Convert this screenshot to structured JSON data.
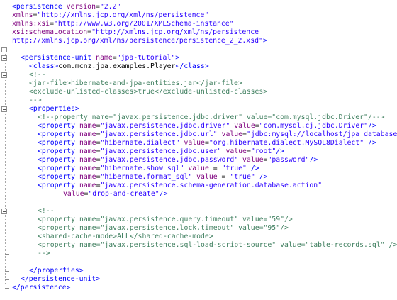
{
  "editor": {
    "lines": [
      {
        "indent": 0,
        "segs": [
          [
            "tag",
            "<persistence "
          ],
          [
            "attr",
            "version"
          ],
          [
            "txt",
            "="
          ],
          [
            "str",
            "\"2.2\""
          ]
        ]
      },
      {
        "indent": 0,
        "segs": [
          [
            "attr",
            "xmlns"
          ],
          [
            "txt",
            "="
          ],
          [
            "str",
            "\"http://xmlns.jcp.org/xml/ns/persistence\""
          ]
        ]
      },
      {
        "indent": 0,
        "segs": [
          [
            "attr",
            "xmlns:xsi"
          ],
          [
            "txt",
            "="
          ],
          [
            "str",
            "\"http://www.w3.org/2001/XMLSchema-instance\""
          ]
        ]
      },
      {
        "indent": 0,
        "segs": [
          [
            "attr",
            "xsi:schemaLocation"
          ],
          [
            "txt",
            "="
          ],
          [
            "str",
            "\"http://xmlns.jcp.org/xml/ns/persistence"
          ]
        ]
      },
      {
        "indent": 0,
        "segs": [
          [
            "str",
            "http://xmlns.jcp.org/xml/ns/persistence/persistence_2_2.xsd\""
          ],
          [
            "tag",
            ">"
          ]
        ]
      },
      {
        "indent": 0,
        "segs": []
      },
      {
        "indent": 1,
        "segs": [
          [
            "tag",
            "<persistence-unit "
          ],
          [
            "attr",
            "name"
          ],
          [
            "txt",
            "="
          ],
          [
            "str",
            "\"jpa-tutorial\""
          ],
          [
            "tag",
            ">"
          ]
        ]
      },
      {
        "indent": 2,
        "segs": [
          [
            "tag",
            "<class>"
          ],
          [
            "txt",
            "com.mcnz.jpa.examples.Player"
          ],
          [
            "tag",
            "</class>"
          ]
        ]
      },
      {
        "indent": 2,
        "segs": [
          [
            "cmt",
            "<!--"
          ]
        ]
      },
      {
        "indent": 2,
        "segs": [
          [
            "cmt",
            "<jar-file>hibernate-and-jpa-entities.jar</jar-file>"
          ]
        ]
      },
      {
        "indent": 2,
        "segs": [
          [
            "cmt",
            "<exclude-unlisted-classes>true</exclude-unlisted-classes>"
          ]
        ]
      },
      {
        "indent": 2,
        "segs": [
          [
            "cmt",
            "-->"
          ]
        ]
      },
      {
        "indent": 2,
        "segs": [
          [
            "tag",
            "<properties>"
          ]
        ]
      },
      {
        "indent": 3,
        "segs": [
          [
            "cmt",
            "<!--property name=\"javax.persistence.jdbc.driver\" value=\"com.mysql.jdbc.Driver\"/-->"
          ]
        ]
      },
      {
        "indent": 3,
        "segs": [
          [
            "tag",
            "<property "
          ],
          [
            "attr",
            "name"
          ],
          [
            "txt",
            "="
          ],
          [
            "str",
            "\"javax.persistence.jdbc.driver\""
          ],
          [
            "txt",
            " "
          ],
          [
            "attr",
            "value"
          ],
          [
            "txt",
            "="
          ],
          [
            "str",
            "\"com.mysql.cj.jdbc.Driver\""
          ],
          [
            "tag",
            "/>"
          ]
        ]
      },
      {
        "indent": 3,
        "segs": [
          [
            "tag",
            "<property "
          ],
          [
            "attr",
            "name"
          ],
          [
            "txt",
            "="
          ],
          [
            "str",
            "\"javax.persistence.jdbc.url\""
          ],
          [
            "txt",
            " "
          ],
          [
            "attr",
            "value"
          ],
          [
            "txt",
            "="
          ],
          [
            "str",
            "\"jdbc:mysql://localhost/jpa_database\""
          ],
          [
            "tag",
            "/>"
          ]
        ]
      },
      {
        "indent": 3,
        "segs": [
          [
            "tag",
            "<property "
          ],
          [
            "attr",
            "name"
          ],
          [
            "txt",
            "="
          ],
          [
            "str",
            "\"hibernate.dialect\""
          ],
          [
            "txt",
            " "
          ],
          [
            "attr",
            "value"
          ],
          [
            "txt",
            "="
          ],
          [
            "str",
            "\"org.hibernate.dialect.MySQL8Dialect\""
          ],
          [
            "txt",
            " "
          ],
          [
            "tag",
            "/>"
          ]
        ]
      },
      {
        "indent": 3,
        "segs": [
          [
            "tag",
            "<property "
          ],
          [
            "attr",
            "name"
          ],
          [
            "txt",
            "="
          ],
          [
            "str",
            "\"javax.persistence.jdbc.user\""
          ],
          [
            "txt",
            " "
          ],
          [
            "attr",
            "value"
          ],
          [
            "txt",
            "="
          ],
          [
            "str",
            "\"root\""
          ],
          [
            "tag",
            "/>"
          ]
        ]
      },
      {
        "indent": 3,
        "segs": [
          [
            "tag",
            "<property "
          ],
          [
            "attr",
            "name"
          ],
          [
            "txt",
            "="
          ],
          [
            "str",
            "\"javax.persistence.jdbc.password\""
          ],
          [
            "txt",
            " "
          ],
          [
            "attr",
            "value"
          ],
          [
            "txt",
            "="
          ],
          [
            "str",
            "\"password\""
          ],
          [
            "tag",
            "/>"
          ]
        ]
      },
      {
        "indent": 3,
        "segs": [
          [
            "tag",
            "<property "
          ],
          [
            "attr",
            "name"
          ],
          [
            "txt",
            "="
          ],
          [
            "str",
            "\"hibernate.show_sql\""
          ],
          [
            "txt",
            " "
          ],
          [
            "attr",
            "value"
          ],
          [
            "txt",
            " = "
          ],
          [
            "str",
            "\"true\""
          ],
          [
            "txt",
            " "
          ],
          [
            "tag",
            "/>"
          ]
        ]
      },
      {
        "indent": 3,
        "segs": [
          [
            "tag",
            "<property "
          ],
          [
            "attr",
            "name"
          ],
          [
            "txt",
            "="
          ],
          [
            "str",
            "\"hibernate.format_sql\""
          ],
          [
            "txt",
            " "
          ],
          [
            "attr",
            "value"
          ],
          [
            "txt",
            " = "
          ],
          [
            "str",
            "\"true\""
          ],
          [
            "txt",
            " "
          ],
          [
            "tag",
            "/>"
          ]
        ]
      },
      {
        "indent": 3,
        "segs": [
          [
            "tag",
            "<property "
          ],
          [
            "attr",
            "name"
          ],
          [
            "txt",
            "="
          ],
          [
            "str",
            "\"javax.persistence.schema-generation.database.action\""
          ]
        ]
      },
      {
        "indent": 6,
        "segs": [
          [
            "attr",
            "value"
          ],
          [
            "txt",
            "="
          ],
          [
            "str",
            "\"drop-and-create\""
          ],
          [
            "tag",
            "/>"
          ]
        ]
      },
      {
        "indent": 0,
        "segs": []
      },
      {
        "indent": 3,
        "segs": [
          [
            "cmt",
            "<!--"
          ]
        ]
      },
      {
        "indent": 3,
        "segs": [
          [
            "cmt",
            "<property name=\"javax.persistence.query.timeout\" value=\"59\"/>"
          ]
        ]
      },
      {
        "indent": 3,
        "segs": [
          [
            "cmt",
            "<property name=\"javax.persistence.lock.timeout\" value=\"95\"/>"
          ]
        ]
      },
      {
        "indent": 3,
        "segs": [
          [
            "cmt",
            "<shared-cache-mode>ALL</shared-cache-mode>"
          ]
        ]
      },
      {
        "indent": 3,
        "segs": [
          [
            "cmt",
            "<property name=\"javax.persistence.sql-load-script-source\" value=\"table-records.sql\" />"
          ]
        ]
      },
      {
        "indent": 3,
        "segs": [
          [
            "cmt",
            "-->"
          ]
        ]
      },
      {
        "indent": 0,
        "segs": []
      },
      {
        "indent": 2,
        "segs": [
          [
            "tag",
            "</properties>"
          ]
        ]
      },
      {
        "indent": 1,
        "segs": [
          [
            "tag",
            "</persistence-unit>"
          ]
        ]
      },
      {
        "indent": 0,
        "segs": [
          [
            "tag",
            "</persistence>"
          ]
        ]
      }
    ],
    "folds": [
      5,
      6,
      8,
      12,
      24
    ]
  }
}
